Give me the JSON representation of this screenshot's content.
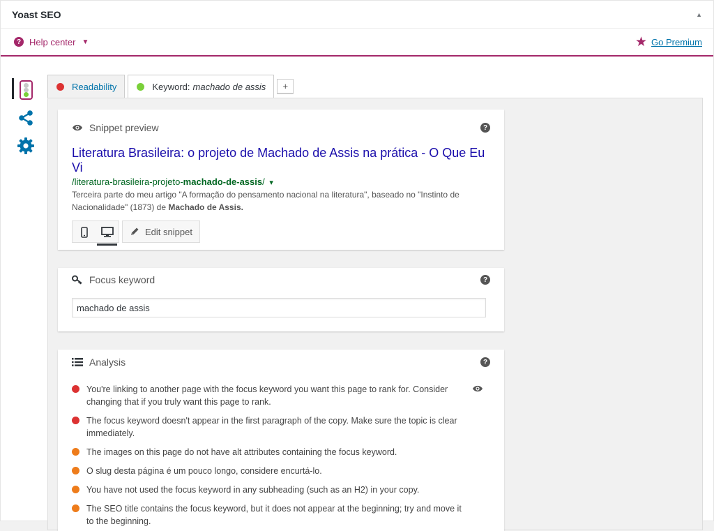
{
  "metabox": {
    "title": "Yoast SEO",
    "toggle_glyph": "▲"
  },
  "helpbar": {
    "help_icon": "?",
    "help_label": "Help center",
    "caret": "▼",
    "premium_label": "Go Premium",
    "star": "★"
  },
  "tabs": [
    {
      "label": "Readability",
      "status": "red"
    },
    {
      "label_prefix": "Keyword:",
      "label_keyword": "machado de assis",
      "status": "green"
    }
  ],
  "add_tab_label": "+",
  "snippet": {
    "header": "Snippet preview",
    "help": "?",
    "title": "Literatura Brasileira: o projeto de Machado de Assis na prática - O Que Eu Vi",
    "url_plain": "/literatura-brasileira-projeto-",
    "url_bold": "machado-de-assis",
    "url_trail": "/",
    "url_caret": "▾",
    "description_plain": "Terceira parte do meu artigo \"A formação do pensamento nacional na literatura\", baseado no \"Instinto de Nacionalidade\" (1873) de ",
    "description_bold": "Machado de Assis.",
    "edit_label": "Edit snippet"
  },
  "focus": {
    "header": "Focus keyword",
    "help": "?",
    "value": "machado de assis"
  },
  "analysis": {
    "header": "Analysis",
    "help": "?",
    "items": [
      {
        "status": "red",
        "text": "You're linking to another page with the focus keyword you want this page to rank for. Consider changing that if you truly want this page to rank."
      },
      {
        "status": "red",
        "text": "The focus keyword doesn't appear in the first paragraph of the copy. Make sure the topic is clear immediately."
      },
      {
        "status": "orange",
        "text": "The images on this page do not have alt attributes containing the focus keyword."
      },
      {
        "status": "orange",
        "text": "O slug desta página é um pouco longo, considere encurtá-lo."
      },
      {
        "status": "orange",
        "text": "You have not used the focus keyword in any subheading (such as an H2) in your copy."
      },
      {
        "status": "orange",
        "text": "The SEO title contains the focus keyword, but it does not appear at the beginning; try and move it to the beginning."
      }
    ]
  },
  "colors": {
    "brand": "#a4286a",
    "link": "#0073aa",
    "red": "#dc3232",
    "orange": "#ee7c1b",
    "green": "#7ad03a",
    "snippet_title": "#1a0dab",
    "snippet_url": "#006621"
  },
  "icons": {
    "sidebar": [
      "traffic-light-icon",
      "share-icon",
      "gear-icon"
    ],
    "snippet": "eye-icon",
    "focus": "key-icon",
    "analysis": "list-icon",
    "mobile": "mobile-icon",
    "desktop": "desktop-icon",
    "edit": "pencil-icon"
  }
}
